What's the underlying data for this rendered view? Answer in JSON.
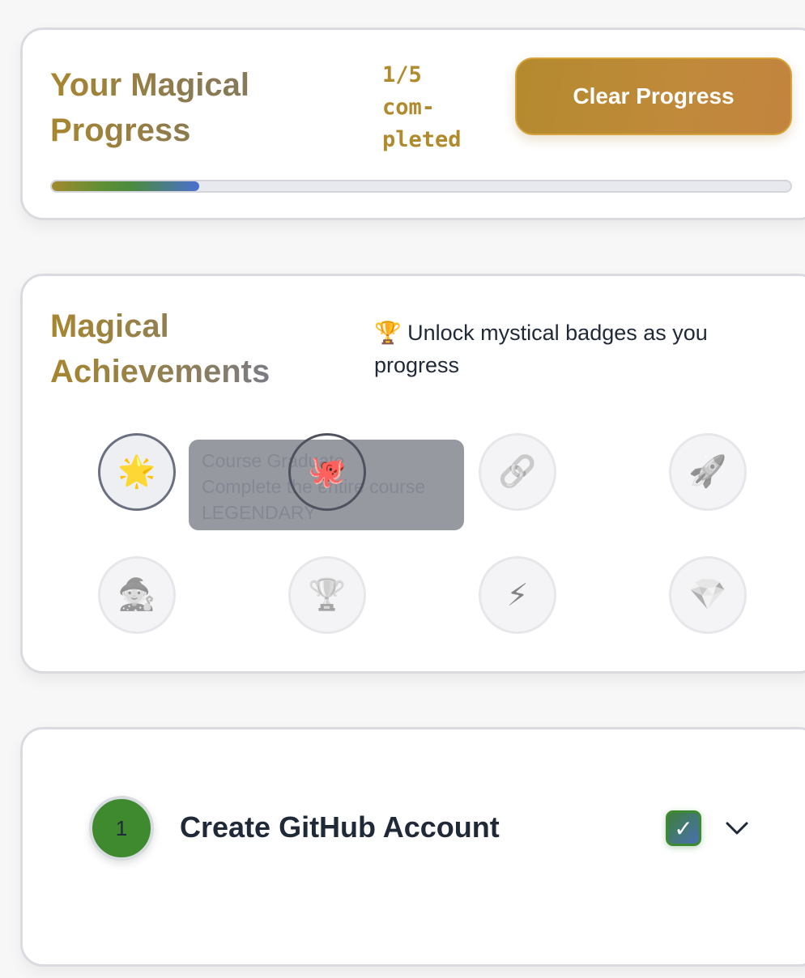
{
  "progress": {
    "title": "Your Magical Progress",
    "count_text": "1/5\ncom-\npleted",
    "completed": 1,
    "total": 5,
    "fill_fraction": 0.2,
    "clear_label": "Clear Progress"
  },
  "achievements": {
    "title": "Magical Achievements",
    "subtitle": "🏆 Unlock mystical badges as you progress",
    "badges": [
      {
        "icon": "star-icon",
        "glyph": "🌟",
        "state": "unlocked"
      },
      {
        "icon": "octopus-icon",
        "glyph": "🐙",
        "state": "active"
      },
      {
        "icon": "link-icon",
        "glyph": "🔗",
        "state": "locked"
      },
      {
        "icon": "rocket-icon",
        "glyph": "🚀",
        "state": "locked"
      },
      {
        "icon": "wizard-icon",
        "glyph": "🧙",
        "state": "locked"
      },
      {
        "icon": "trophy-icon",
        "glyph": "🏆",
        "state": "locked"
      },
      {
        "icon": "lightning-icon",
        "glyph": "⚡",
        "state": "locked"
      },
      {
        "icon": "diamond-icon",
        "glyph": "💎",
        "state": "locked"
      }
    ],
    "tooltip": {
      "title": "Course Graduate",
      "description": "Complete the entire course",
      "rarity": "LEGENDARY"
    }
  },
  "step": {
    "number": "1",
    "title": "Create GitHub Account",
    "checked": true,
    "check_glyph": "✓"
  },
  "colors": {
    "gold": "#b48a2e",
    "green": "#3f8a2e",
    "blue": "#4b6fd1"
  }
}
